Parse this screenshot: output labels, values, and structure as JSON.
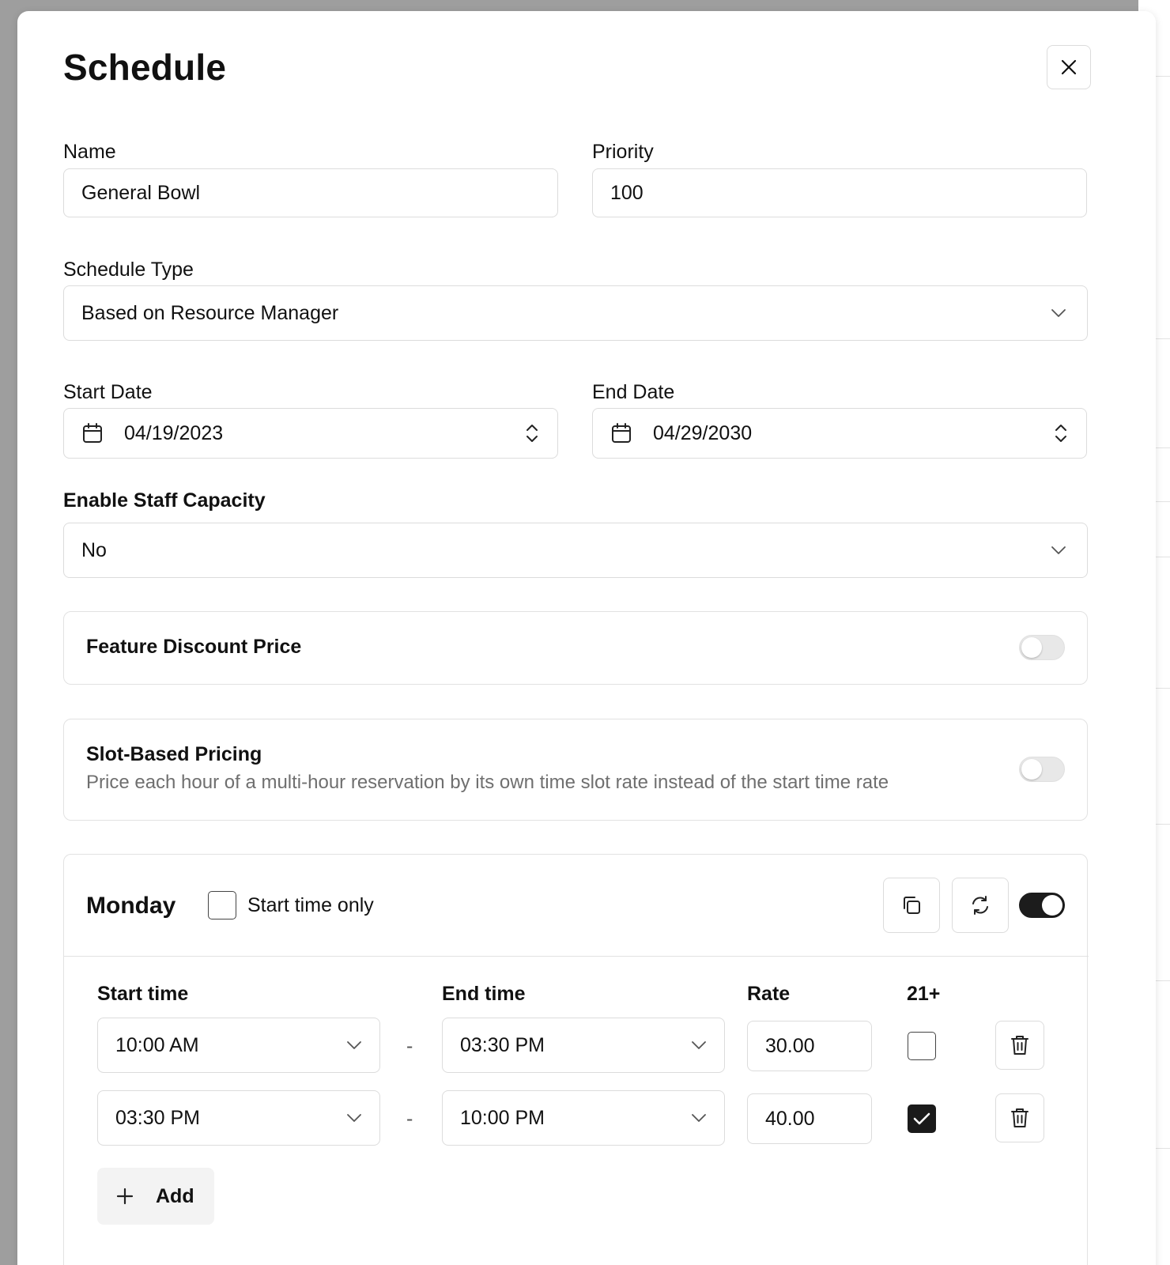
{
  "dialog": {
    "title": "Schedule"
  },
  "form": {
    "name_label": "Name",
    "name_value": "General Bowl",
    "priority_label": "Priority",
    "priority_value": "100",
    "schedule_type_label": "Schedule Type",
    "schedule_type_value": "Based on Resource Manager",
    "start_date_label": "Start Date",
    "start_date_value": "04/19/2023",
    "end_date_label": "End Date",
    "end_date_value": "04/29/2030",
    "staff_capacity_label": "Enable Staff Capacity",
    "staff_capacity_value": "No"
  },
  "feature_discount": {
    "title": "Feature Discount Price",
    "enabled": false
  },
  "slot_pricing": {
    "title": "Slot-Based Pricing",
    "description": "Price each hour of a multi-hour reservation by its own time slot rate instead of the start time rate",
    "enabled": false
  },
  "day": {
    "name": "Monday",
    "start_time_only_label": "Start time only",
    "start_time_only": false,
    "enabled": true,
    "columns": {
      "start": "Start time",
      "end": "End time",
      "rate": "Rate",
      "age": "21+"
    },
    "separator": "-",
    "slots": [
      {
        "start": "10:00 AM",
        "end": "03:30 PM",
        "rate": "30.00",
        "age21": false
      },
      {
        "start": "03:30 PM",
        "end": "10:00 PM",
        "rate": "40.00",
        "age21": true
      }
    ],
    "add_label": "Add"
  },
  "icons": {
    "close": "close-icon",
    "chevron": "chevron-down-icon",
    "calendar": "calendar-icon",
    "stepper": "chevron-up-down-icon",
    "copy": "copy-icon",
    "refresh": "refresh-icon",
    "trash": "trash-icon",
    "plus": "plus-icon",
    "check": "check-icon"
  }
}
